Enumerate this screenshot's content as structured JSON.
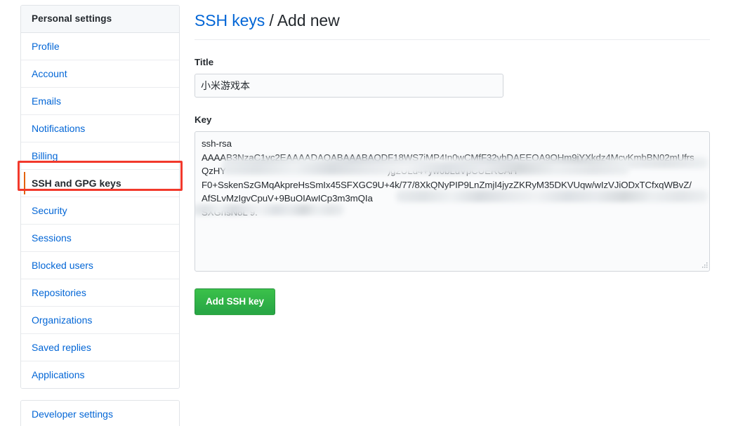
{
  "sidebar": {
    "header": "Personal settings",
    "items": [
      {
        "label": "Profile",
        "selected": false
      },
      {
        "label": "Account",
        "selected": false
      },
      {
        "label": "Emails",
        "selected": false
      },
      {
        "label": "Notifications",
        "selected": false
      },
      {
        "label": "Billing",
        "selected": false
      },
      {
        "label": "SSH and GPG keys",
        "selected": true
      },
      {
        "label": "Security",
        "selected": false
      },
      {
        "label": "Sessions",
        "selected": false
      },
      {
        "label": "Blocked users",
        "selected": false
      },
      {
        "label": "Repositories",
        "selected": false
      },
      {
        "label": "Organizations",
        "selected": false
      },
      {
        "label": "Saved replies",
        "selected": false
      },
      {
        "label": "Applications",
        "selected": false
      }
    ],
    "secondary_items": [
      {
        "label": "Developer settings"
      }
    ],
    "selected_accent_color": "#e36209",
    "annotation_color": "#f2392c"
  },
  "main": {
    "heading": {
      "link_text": "SSH keys",
      "separator": " / ",
      "current": "Add new"
    },
    "title_field": {
      "label": "Title",
      "value": "小米游戏本",
      "placeholder": ""
    },
    "key_field": {
      "label": "Key",
      "placeholder": "",
      "lines": [
        "ssh-rsa",
        "AAAAB3NzaC1yc2EAAAADAQABAAABAQDF18WS7iMP4In0wCMfF32ybDAEEOA9OHm9jYXkdz4McvKmbBN02mUfrs",
        "QzHY                                                                )g2ULd4+yw0bLuVpCUERCAH",
        "F0+SskenSzGMqAkpreHsSmIx45SFXGC9U+4k/77/8XkQNyPIP9LnZmjI4jyzZKRyM35DKVUqw/wIzVJiODxTCfxqWBvZ/",
        "AfSLvMzIgvCpuV+9BuOIAwICp3m3mQIa",
        "SXGnsN8L 9."
      ]
    },
    "submit_button": {
      "label": "Add SSH key",
      "color": "#28a745"
    }
  }
}
